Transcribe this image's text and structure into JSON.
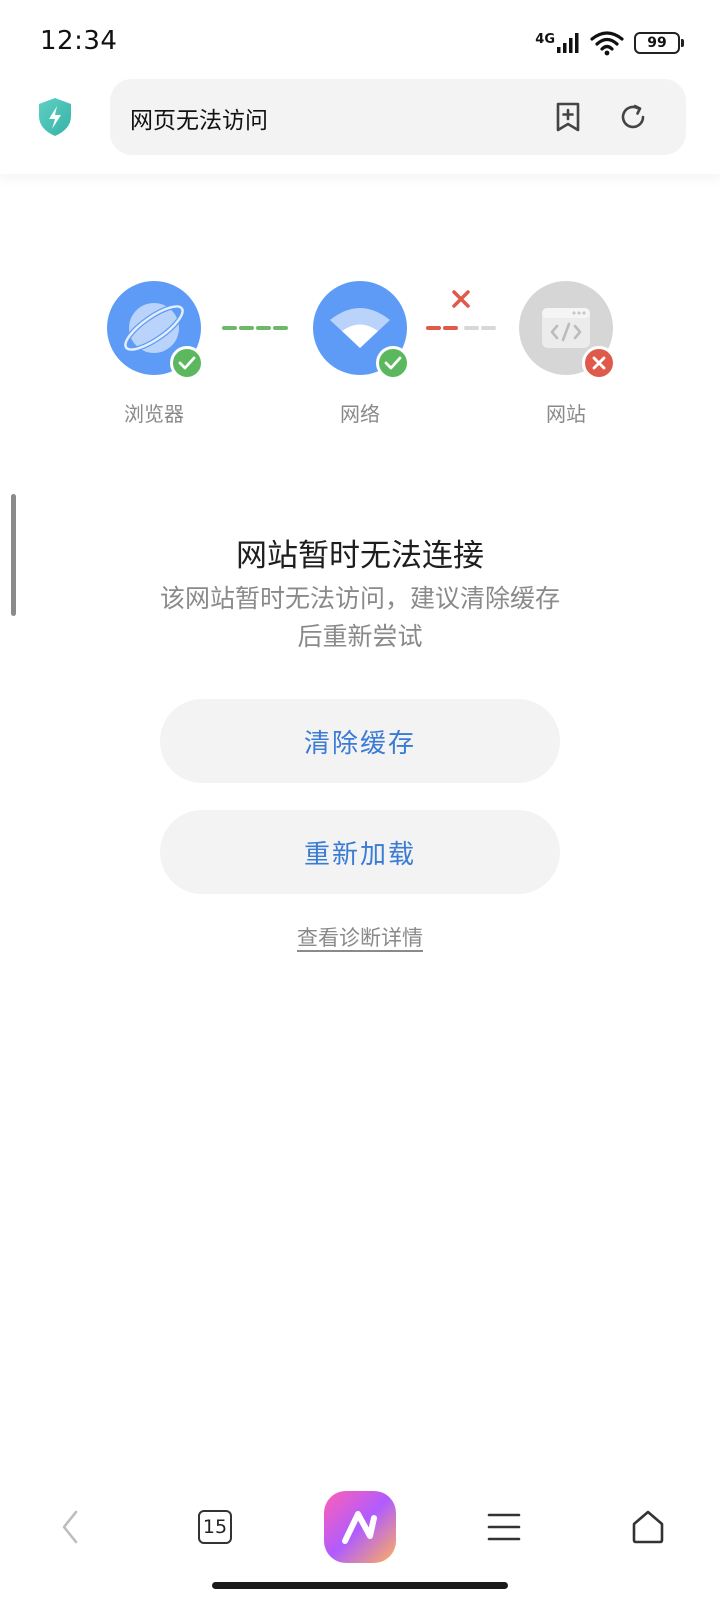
{
  "status": {
    "time": "12:34",
    "network": "4G",
    "battery": "99"
  },
  "address_bar": {
    "title": "网页无法访问"
  },
  "diagnosis": {
    "nodes": [
      {
        "label": "浏览器",
        "status": "ok"
      },
      {
        "label": "网络",
        "status": "ok"
      },
      {
        "label": "网站",
        "status": "error"
      }
    ]
  },
  "message": {
    "title": "网站暂时无法连接",
    "description": "该网站暂时无法访问，建议清除缓存后重新尝试"
  },
  "actions": {
    "clear_cache": "清除缓存",
    "reload": "重新加载",
    "details": "查看诊断详情"
  },
  "bottom_nav": {
    "tab_count": "15"
  },
  "colors": {
    "accent": "#3a7bd5",
    "node_blue": "#5e9bf7",
    "ok_green": "#5bb85e",
    "error_red": "#e05a4c",
    "site_gray": "#d6d6d6",
    "pill_bg": "#f3f3f3"
  }
}
